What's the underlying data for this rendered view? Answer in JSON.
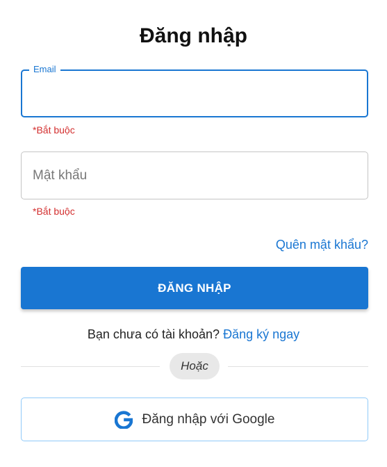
{
  "title": "Đăng nhập",
  "email": {
    "label": "Email",
    "value": "",
    "error": "*Bắt buộc"
  },
  "password": {
    "placeholder": "Mật khẩu",
    "value": "",
    "error": "*Bắt buộc"
  },
  "forgot_link": "Quên mật khẩu?",
  "login_button": "ĐĂNG NHẬP",
  "signup": {
    "prompt": "Bạn chưa có tài khoản?",
    "link": "Đăng ký ngay"
  },
  "divider_text": "Hoặc",
  "google_button": {
    "label": "Đăng nhập với Google",
    "icon": "google-icon"
  },
  "colors": {
    "primary": "#1976d2",
    "error": "#d32f2f"
  }
}
